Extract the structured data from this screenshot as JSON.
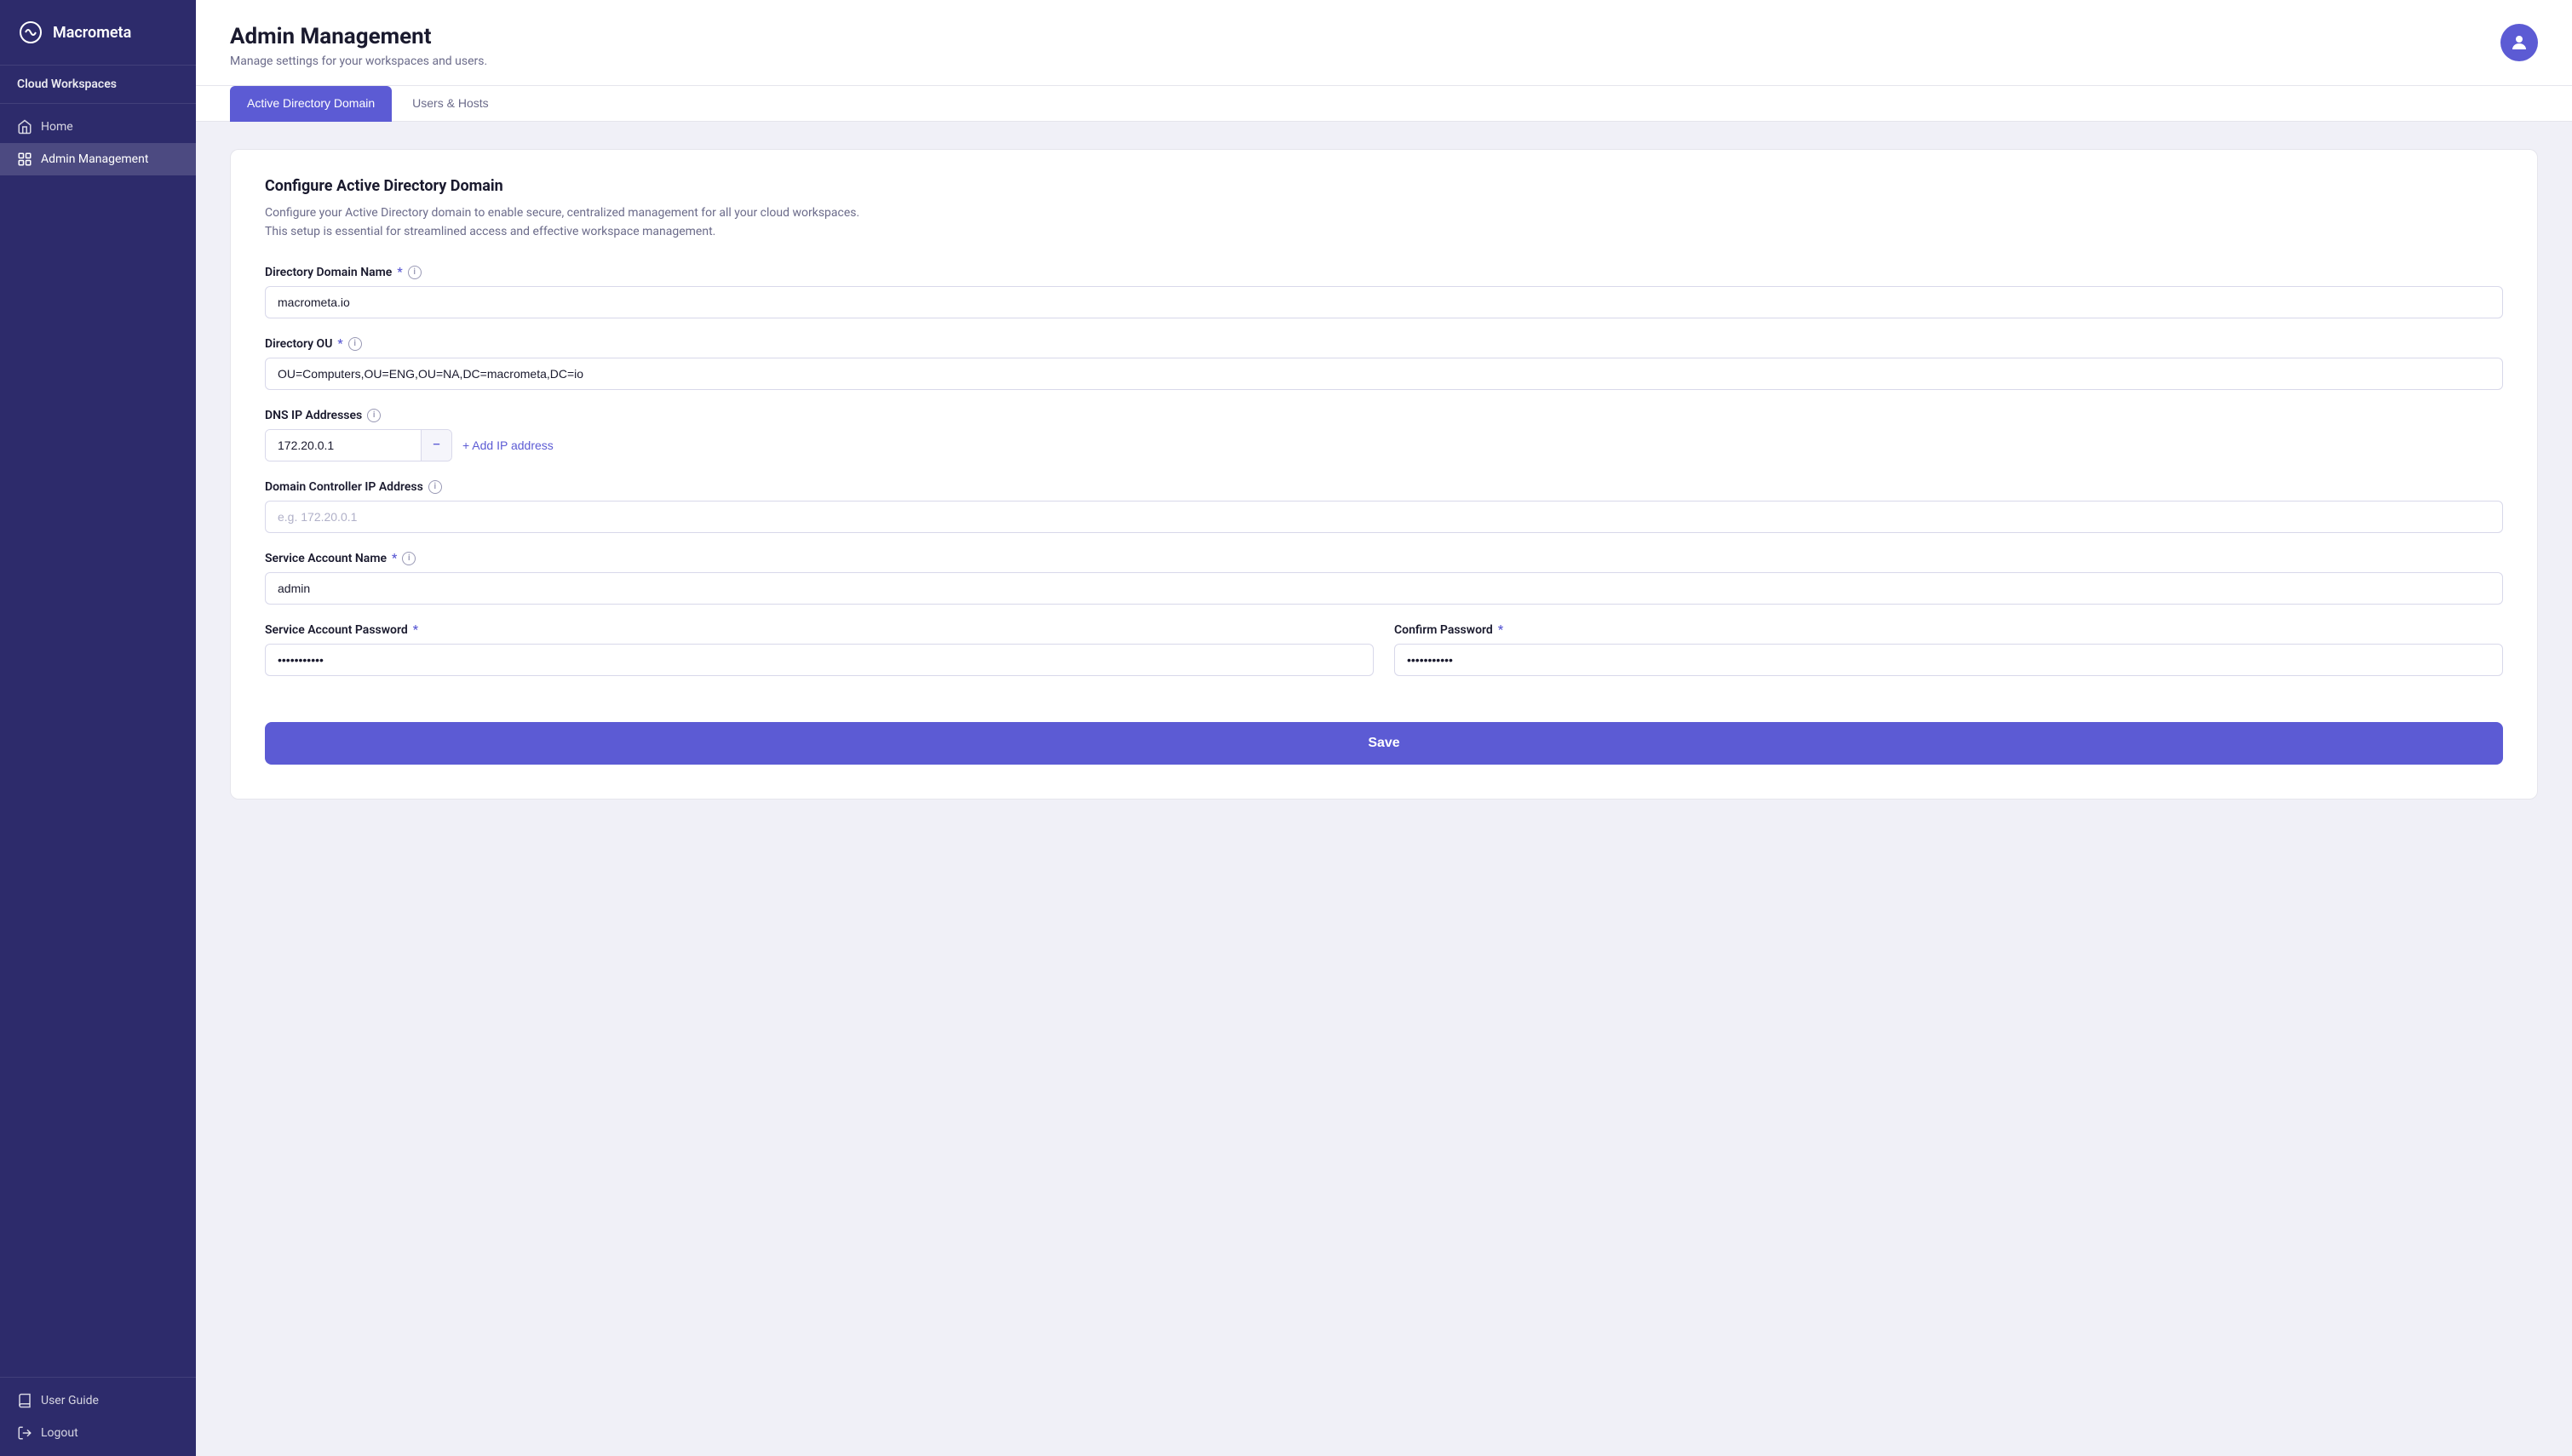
{
  "sidebar": {
    "logo_text": "Macrometa",
    "cloud_workspaces": "Cloud Workspaces",
    "nav_items": [
      {
        "id": "home",
        "label": "Home",
        "icon": "home-icon",
        "active": false
      },
      {
        "id": "admin-management",
        "label": "Admin Management",
        "icon": "admin-icon",
        "active": true
      }
    ],
    "bottom_items": [
      {
        "id": "user-guide",
        "label": "User Guide",
        "icon": "book-icon"
      },
      {
        "id": "logout",
        "label": "Logout",
        "icon": "logout-icon"
      }
    ]
  },
  "header": {
    "title": "Admin Management",
    "subtitle": "Manage settings for your workspaces and users.",
    "avatar_icon": "user-icon"
  },
  "tabs": [
    {
      "id": "active-directory",
      "label": "Active Directory Domain",
      "active": true
    },
    {
      "id": "users-hosts",
      "label": "Users & Hosts",
      "active": false
    }
  ],
  "form": {
    "card_title": "Configure Active Directory Domain",
    "card_desc_line1": "Configure your Active Directory domain to enable secure, centralized management for all your cloud workspaces.",
    "card_desc_line2": "This setup is essential for streamlined access and effective workspace management.",
    "fields": {
      "domain_name_label": "Directory Domain Name",
      "domain_name_value": "macrometa.io",
      "directory_ou_label": "Directory OU",
      "directory_ou_value": "OU=Computers,OU=ENG,OU=NA,DC=macrometa,DC=io",
      "dns_label": "DNS IP Addresses",
      "dns_value": "172.20.0.1",
      "add_ip_label": "+ Add IP address",
      "domain_controller_label": "Domain Controller IP Address",
      "domain_controller_placeholder": "e.g. 172.20.0.1",
      "service_account_label": "Service Account Name",
      "service_account_value": "admin",
      "password_label": "Service Account Password",
      "password_value": "·········",
      "confirm_password_label": "Confirm Password",
      "confirm_password_value": "·········"
    },
    "save_label": "Save"
  }
}
